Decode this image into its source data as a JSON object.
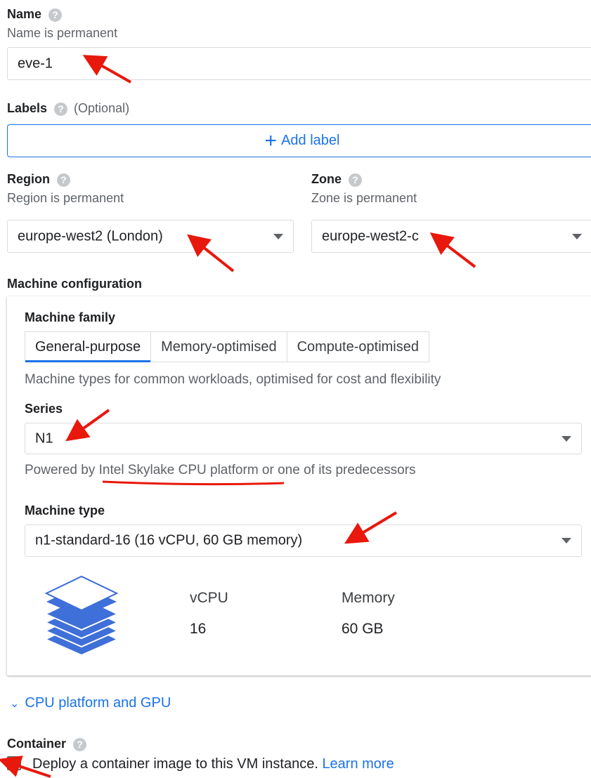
{
  "name_section": {
    "title": "Name",
    "help": "?",
    "subtitle": "Name is permanent",
    "value": "eve-1"
  },
  "labels_section": {
    "title": "Labels",
    "help": "?",
    "optional": "(Optional)",
    "add_plus": "+",
    "add_label": "Add label"
  },
  "region": {
    "title": "Region",
    "help": "?",
    "subtitle": "Region is permanent",
    "selected": "europe-west2 (London)"
  },
  "zone": {
    "title": "Zone",
    "help": "?",
    "subtitle": "Zone is permanent",
    "selected": "europe-west2-c"
  },
  "machine_config": {
    "title": "Machine configuration",
    "family_title": "Machine family",
    "tabs": [
      {
        "label": "General-purpose",
        "active": true
      },
      {
        "label": "Memory-optimised",
        "active": false
      },
      {
        "label": "Compute-optimised",
        "active": false
      }
    ],
    "family_desc": "Machine types for common workloads, optimised for cost and flexibility",
    "series_title": "Series",
    "series_value": "N1",
    "powered_prefix": "Powered by ",
    "powered_link": "Intel Skylake CPU platform",
    "powered_suffix": " or one of its predecessors",
    "type_title": "Machine type",
    "type_value": "n1-standard-16 (16 vCPU, 60 GB memory)",
    "vcpu_label": "vCPU",
    "vcpu_value": "16",
    "memory_label": "Memory",
    "memory_value": "60 GB"
  },
  "cpu_platform_link": "CPU platform and GPU",
  "container": {
    "title": "Container",
    "help": "?",
    "checkbox_text": "Deploy a container image to this VM instance.",
    "learn_more": "Learn more",
    "checked": false
  },
  "colors": {
    "accent": "#1a73e8",
    "annotation_red": "#e8180c",
    "stack_blue": "#3f6fd8"
  }
}
